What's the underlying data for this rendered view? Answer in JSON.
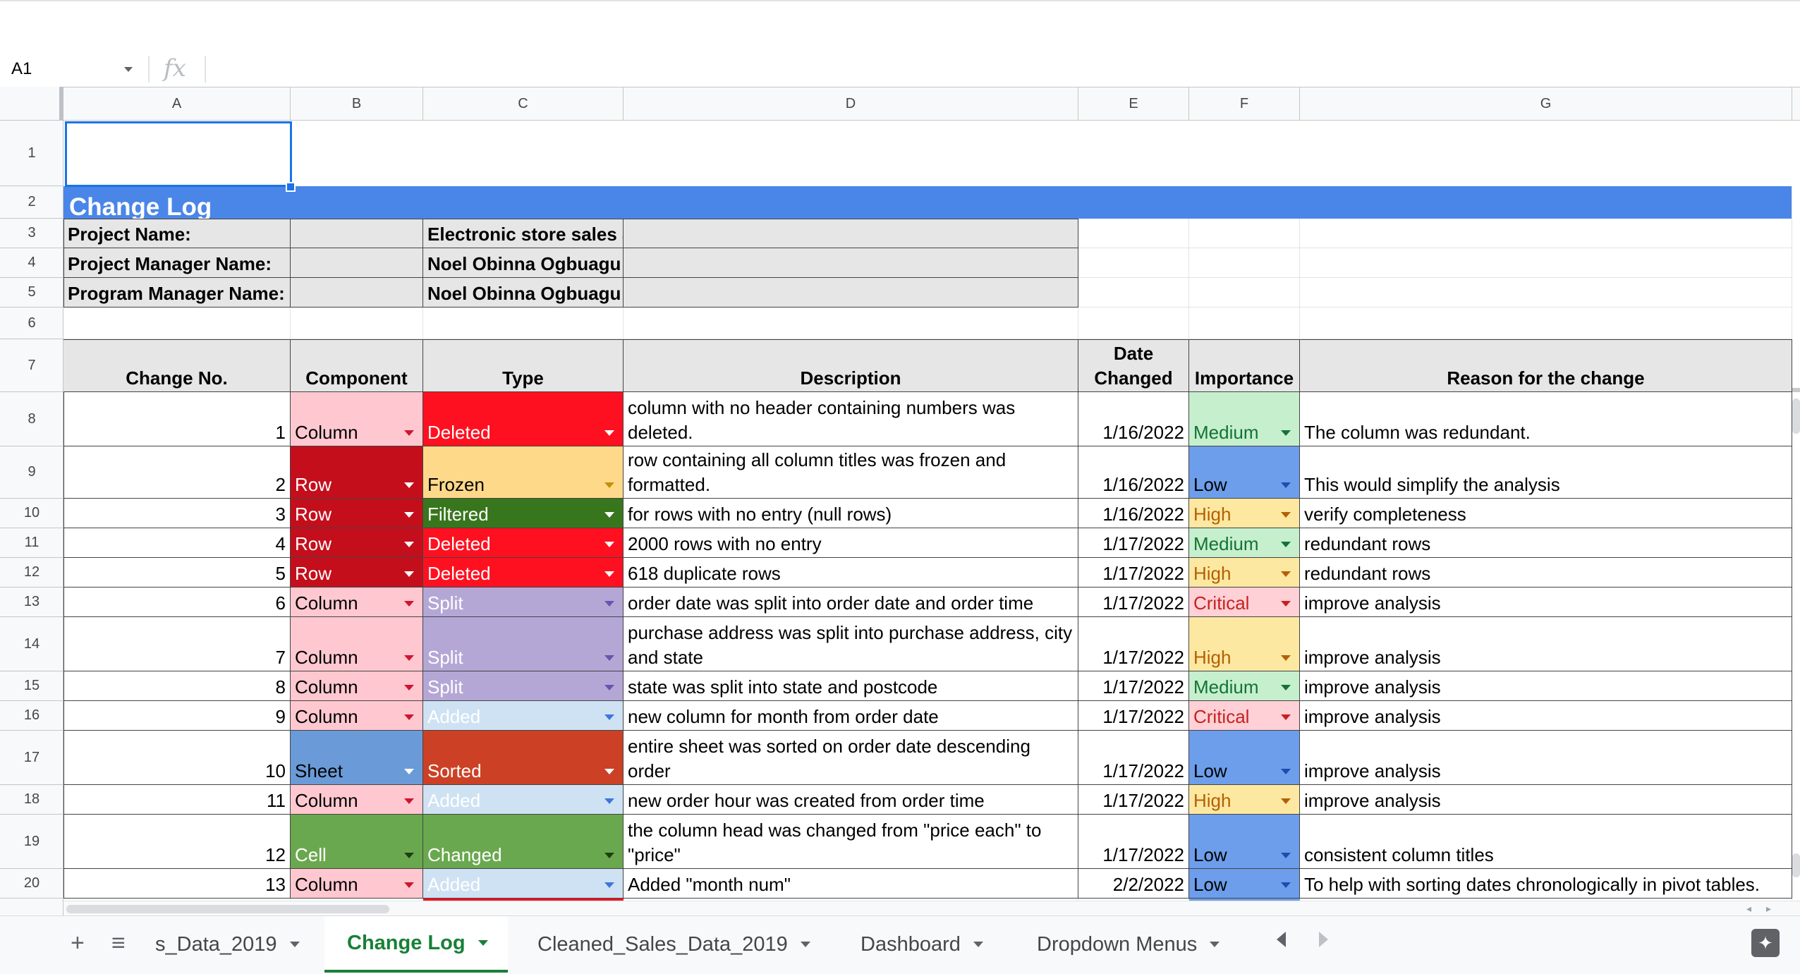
{
  "name_box": "A1",
  "fx_icon": "fx",
  "columns": [
    "A",
    "B",
    "C",
    "D",
    "E",
    "F",
    "G"
  ],
  "rows": [
    "1",
    "2",
    "3",
    "4",
    "5",
    "6",
    "7",
    "8",
    "9",
    "10",
    "11",
    "12",
    "13",
    "14",
    "15",
    "16",
    "17",
    "18",
    "19",
    "20"
  ],
  "title": "Change Log",
  "info": {
    "project_label": "Project Name:",
    "project_value": "Electronic store sales analysis",
    "pm_label": "Project Manager Name:",
    "pm_value": "Noel Obinna Ogbuagu",
    "prog_label": "Program Manager Name:",
    "prog_value": "Noel Obinna Ogbuagu"
  },
  "headers": {
    "change_no": "Change No.",
    "component": "Component",
    "type": "Type",
    "description": "Description",
    "date_changed": "Date Changed",
    "importance": "Importance",
    "reason": "Reason for the change"
  },
  "colors": {
    "selection": "#1a73e8",
    "banner": "#4a86e8",
    "active_tab": "#188038"
  },
  "log": [
    {
      "no": "1",
      "component": "Column",
      "type": "Deleted",
      "description": "column with no header containing numbers was deleted.",
      "date": "1/16/2022",
      "importance": "Medium",
      "reason": "The column was redundant."
    },
    {
      "no": "2",
      "component": "Row",
      "type": "Frozen",
      "description": "row containing all column titles was frozen and formatted.",
      "date": "1/16/2022",
      "importance": "Low",
      "reason": "This would simplify the analysis"
    },
    {
      "no": "3",
      "component": "Row",
      "type": "Filtered",
      "description": "for rows with no entry (null rows)",
      "date": "1/16/2022",
      "importance": "High",
      "reason": "verify completeness"
    },
    {
      "no": "4",
      "component": "Row",
      "type": "Deleted",
      "description": "2000 rows with no entry",
      "date": "1/17/2022",
      "importance": "Medium",
      "reason": "redundant rows"
    },
    {
      "no": "5",
      "component": "Row",
      "type": "Deleted",
      "description": "618 duplicate rows",
      "date": "1/17/2022",
      "importance": "High",
      "reason": "redundant rows"
    },
    {
      "no": "6",
      "component": "Column",
      "type": "Split",
      "description": "order date was split into order date and order time",
      "date": "1/17/2022",
      "importance": "Critical",
      "reason": "improve analysis"
    },
    {
      "no": "7",
      "component": "Column",
      "type": "Split",
      "description": "purchase address was split into purchase address, city and state",
      "date": "1/17/2022",
      "importance": "High",
      "reason": "improve analysis"
    },
    {
      "no": "8",
      "component": "Column",
      "type": "Split",
      "description": "state was split into state and postcode",
      "date": "1/17/2022",
      "importance": "Medium",
      "reason": "improve analysis"
    },
    {
      "no": "9",
      "component": "Column",
      "type": "Added",
      "description": "new column for month from order date",
      "date": "1/17/2022",
      "importance": "Critical",
      "reason": "improve analysis"
    },
    {
      "no": "10",
      "component": "Sheet",
      "type": "Sorted",
      "description": "entire sheet was sorted on order date descending order",
      "date": "1/17/2022",
      "importance": "Low",
      "reason": "improve analysis"
    },
    {
      "no": "11",
      "component": "Column",
      "type": "Added",
      "description": "new order hour was created from order time",
      "date": "1/17/2022",
      "importance": "High",
      "reason": "improve analysis"
    },
    {
      "no": "12",
      "component": "Cell",
      "type": "Changed",
      "description": "the column head was changed from \"price each\" to \"price\"",
      "date": "1/17/2022",
      "importance": "Low",
      "reason": "consistent column titles"
    },
    {
      "no": "13",
      "component": "Column",
      "type": "Added",
      "description": "Added \"month num\"",
      "date": "2/2/2022",
      "importance": "Low",
      "reason": "To help with sorting dates chronologically in pivot tables."
    }
  ],
  "tabs": [
    {
      "label": "s_Data_2019",
      "active": false
    },
    {
      "label": "Change Log",
      "active": true
    },
    {
      "label": "Cleaned_Sales_Data_2019",
      "active": false
    },
    {
      "label": "Dashboard",
      "active": false
    },
    {
      "label": "Dropdown Menus",
      "active": false
    }
  ],
  "tabbar_icons": {
    "add": "plus-icon",
    "all_sheets": "list-icon",
    "explore": "explore-icon"
  }
}
